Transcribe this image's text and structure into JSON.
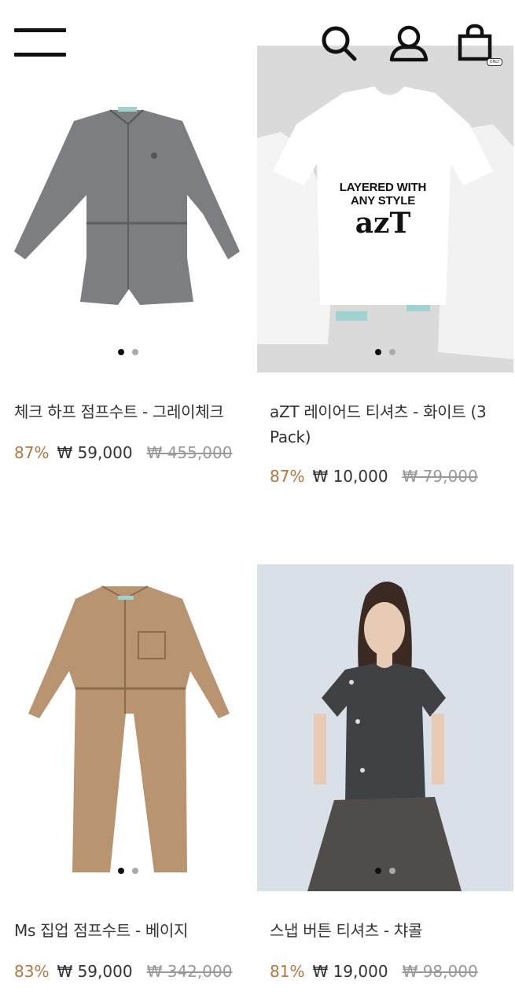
{
  "header": {
    "menu_icon": "hamburger-menu-icon",
    "search_icon": "search-icon",
    "account_icon": "user-icon",
    "cart_icon": "shopping-bag-icon",
    "cart_badge": "ONLY"
  },
  "products": [
    {
      "name": "체크 하프 점프수트 - 그레이체크",
      "discount": "87%",
      "price": "₩ 59,000",
      "original_price": "₩ 455,000"
    },
    {
      "name": "aZT 레이어드 티셔츠 - 화이트 (3 Pack)",
      "discount": "87%",
      "price": "₩ 10,000",
      "original_price": "₩ 79,000",
      "image_text": {
        "line1": "LAYERED WITH",
        "line2": "ANY STYLE",
        "logo": "azT"
      }
    },
    {
      "name": "Ms 집업 점프수트 - 베이지",
      "discount": "83%",
      "price": "₩ 59,000",
      "original_price": "₩ 342,000"
    },
    {
      "name": "스냅 버튼 티셔츠 - 챠콜",
      "discount": "81%",
      "price": "₩ 19,000",
      "original_price": "₩ 98,000"
    }
  ],
  "colors": {
    "discount": "#b5783f",
    "text": "#333333",
    "strike": "#999999"
  }
}
